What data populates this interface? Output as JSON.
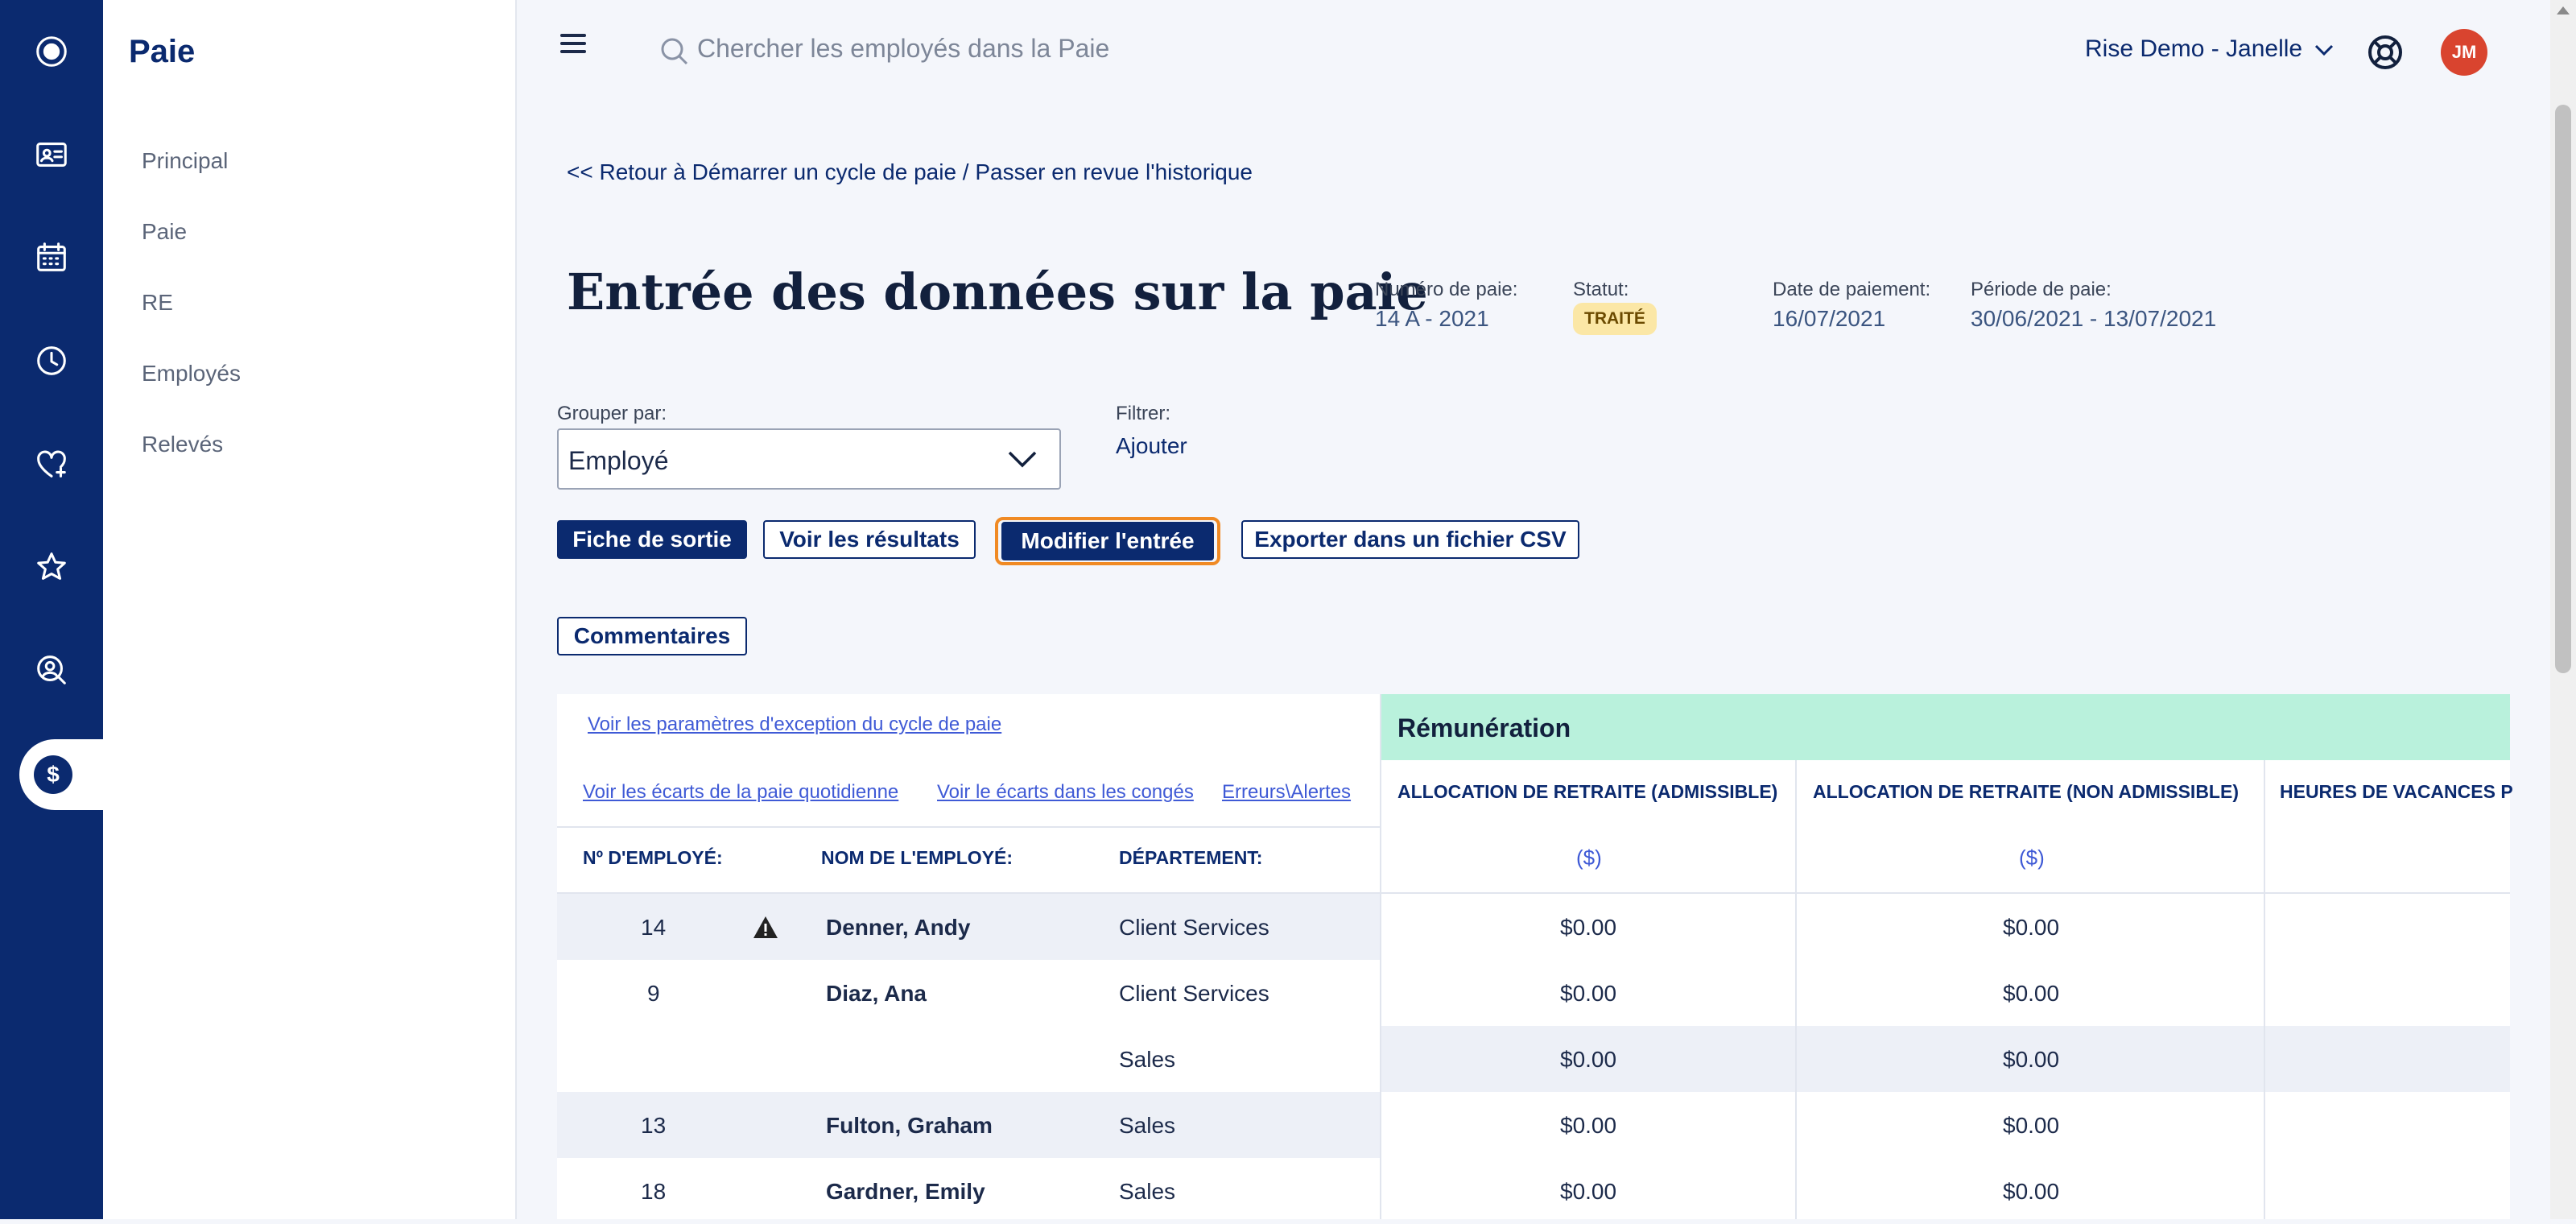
{
  "sidebar": {
    "title": "Paie",
    "items": [
      {
        "label": "Principal"
      },
      {
        "label": "Paie"
      },
      {
        "label": "RE"
      },
      {
        "label": "Employés"
      },
      {
        "label": "Relevés"
      }
    ],
    "active_icon": "$"
  },
  "topbar": {
    "search_placeholder": "Chercher les employés dans la Paie",
    "account": "Rise Demo - Janelle",
    "avatar_initials": "JM"
  },
  "back_link": "<< Retour à Démarrer un cycle de paie / Passer en revue l'historique",
  "page_title": "Entrée des données sur la paie",
  "meta": {
    "pay_number_label": "Numéro de paie:",
    "pay_number": "14 A - 2021",
    "status_label": "Statut:",
    "status": "TRAITÉ",
    "pay_date_label": "Date de paiement:",
    "pay_date": "16/07/2021",
    "pay_period_label": "Période de paie:",
    "pay_period": "30/06/2021 - 13/07/2021"
  },
  "group_by": {
    "label": "Grouper par:",
    "value": "Employé"
  },
  "filter": {
    "label": "Filtrer:",
    "action": "Ajouter"
  },
  "buttons": {
    "exit_sheet": "Fiche de sortie",
    "view_results": "Voir les résultats",
    "modify_entry": "Modifier l'entrée",
    "export_csv": "Exporter dans un fichier CSV",
    "comments": "Commentaires"
  },
  "table": {
    "links": {
      "exceptions": "Voir les paramètres d'exception du cycle de paie",
      "daily_gaps": "Voir les écarts de la paie quotidienne",
      "leave_gaps": "Voir le écarts dans les congés",
      "errors": "Erreurs\\Alertes"
    },
    "section": "Rémunération",
    "columns": {
      "emp_no": "Nº D'EMPLOYÉ:",
      "emp_name": "NOM DE L'EMPLOYÉ:",
      "department": "DÉPARTEMENT:",
      "retire_elig": "ALLOCATION DE RETRAITE (ADMISSIBLE)",
      "retire_nonelig": "ALLOCATION DE RETRAITE (NON ADMISSIBLE)",
      "vacation_hours": "HEURES DE VACANCES P",
      "unit": "($)"
    },
    "rows": [
      {
        "no": "14",
        "name": "Denner, Andy",
        "dept": "Client Services",
        "v1": "$0.00",
        "v2": "$0.00",
        "warning": true
      },
      {
        "no": "9",
        "name": "Diaz, Ana",
        "dept": "Client Services",
        "v1": "$0.00",
        "v2": "$0.00"
      },
      {
        "no": "",
        "name": "",
        "dept": "Sales",
        "v1": "$0.00",
        "v2": "$0.00"
      },
      {
        "no": "13",
        "name": "Fulton, Graham",
        "dept": "Sales",
        "v1": "$0.00",
        "v2": "$0.00"
      },
      {
        "no": "18",
        "name": "Gardner, Emily",
        "dept": "Sales",
        "v1": "$0.00",
        "v2": "$0.00"
      }
    ]
  }
}
